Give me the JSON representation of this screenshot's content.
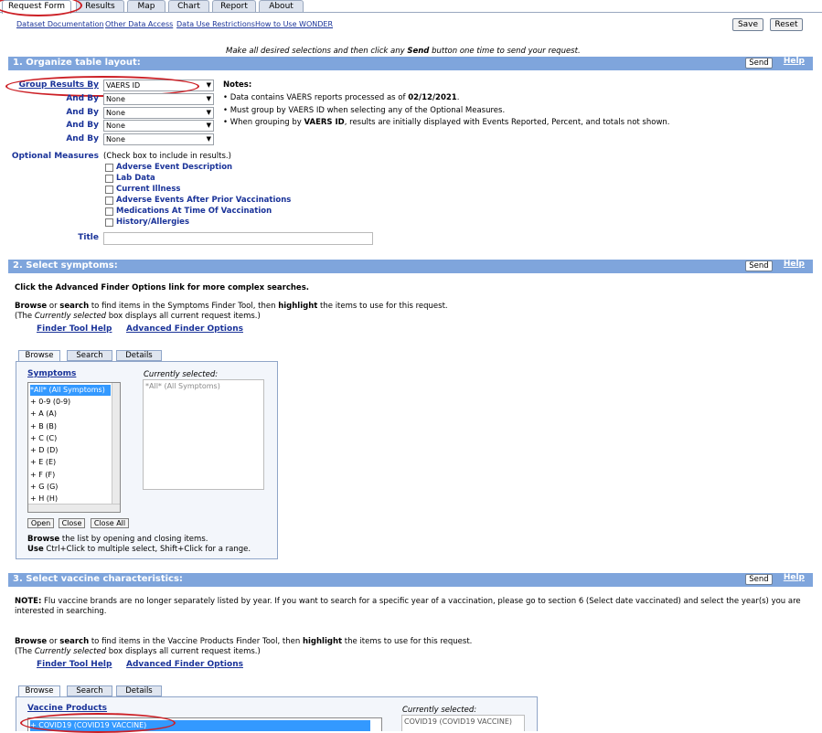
{
  "tabs": [
    "Request Form",
    "Results",
    "Map",
    "Chart",
    "Report",
    "About"
  ],
  "top_links": [
    "Dataset Documentation",
    "Other Data Access",
    "Data Use Restrictions",
    "How to Use WONDER"
  ],
  "buttons": {
    "save": "Save",
    "reset": "Reset",
    "send": "Send",
    "help": "Help"
  },
  "instruction": {
    "pre": "Make all desired selections and then click any ",
    "bold": "Send",
    "post": " button one time to send your request."
  },
  "section1": {
    "title": "1. Organize table layout:",
    "group_label": "Group Results By",
    "group_value": "VAERS ID",
    "and_by_label": "And By",
    "and_by_values": [
      "None",
      "None",
      "None",
      "None"
    ],
    "notes_title": "Notes:",
    "notes": [
      {
        "pre": "Data contains VAERS reports processed as of ",
        "bold": "02/12/2021",
        "post": "."
      },
      {
        "pre": "Must group by VAERS ID when selecting any of the Optional Measures.",
        "bold": "",
        "post": ""
      },
      {
        "pre": "When grouping by ",
        "bold": "VAERS ID",
        "post": ", results are initially displayed with Events Reported, Percent, and totals not shown."
      }
    ],
    "optional_label": "Optional Measures",
    "optional_hint": "(Check box to include in results.)",
    "optional_items": [
      "Adverse Event Description",
      "Lab Data",
      "Current Illness",
      "Adverse Events After Prior Vaccinations",
      "Medications At Time Of Vaccination",
      "History/Allergies"
    ],
    "title_label": "Title"
  },
  "section2": {
    "title": "2. Select symptoms:",
    "intro": "Click the Advanced Finder Options link for more complex searches.",
    "browse_line": {
      "b1": "Browse",
      "t1": " or ",
      "b2": "search",
      "t2": " to find items in the Symptoms Finder Tool, then ",
      "b3": "highlight",
      "t3": " the items to use for this request."
    },
    "note_line": {
      "t1": "(The ",
      "i1": "Currently selected",
      "t2": " box displays all current request items.)"
    },
    "finder_help": "Finder Tool Help",
    "advanced": "Advanced Finder Options",
    "panel_tabs": [
      "Browse",
      "Search",
      "Details"
    ],
    "list_title": "Symptoms",
    "list_items": [
      "*All*  (All Symptoms)",
      "+ 0-9  (0-9)",
      "+ A  (A)",
      "+ B  (B)",
      "+ C  (C)",
      "+ D  (D)",
      "+ E  (E)",
      "+ F  (F)",
      "+ G  (G)",
      "+ H  (H)"
    ],
    "currently_label": "Currently selected:",
    "currently_value": "*All*  (All Symptoms)",
    "list_buttons": [
      "Open",
      "Close",
      "Close All"
    ],
    "help1": {
      "b": "Browse",
      "t": " the list by opening and closing items."
    },
    "help2": {
      "b": "Use",
      "t": " Ctrl+Click to multiple select, Shift+Click for a range."
    }
  },
  "section3": {
    "title": "3. Select vaccine characteristics:",
    "note": {
      "b": "NOTE:",
      "t": " Flu vaccine brands are no longer separately listed by year. If you want to search for a specific year of a vaccination, please go to section 6 (Select date vaccinated) and select the year(s) you are interested in searching."
    },
    "browse_line": {
      "b1": "Browse",
      "t1": " or ",
      "b2": "search",
      "t2": " to find items in the Vaccine Products Finder Tool, then ",
      "b3": "highlight",
      "t3": " the items to use for this request."
    },
    "note_line": {
      "t1": "(The ",
      "i1": "Currently selected",
      "t2": " box displays all current request items.)"
    },
    "finder_help": "Finder Tool Help",
    "advanced": "Advanced Finder Options",
    "panel_tabs": [
      "Browse",
      "Search",
      "Details"
    ],
    "list_title": "Vaccine Products",
    "list_first": "+ COVID19  (COVID19 VACCINE)",
    "currently_label": "Currently selected:",
    "currently_value": "COVID19 (COVID19 VACCINE)"
  },
  "colors": {
    "section_bar": "#7fa5dc",
    "link": "#1a3399",
    "annotation": "#cc1f25",
    "selected": "#3399ff"
  }
}
